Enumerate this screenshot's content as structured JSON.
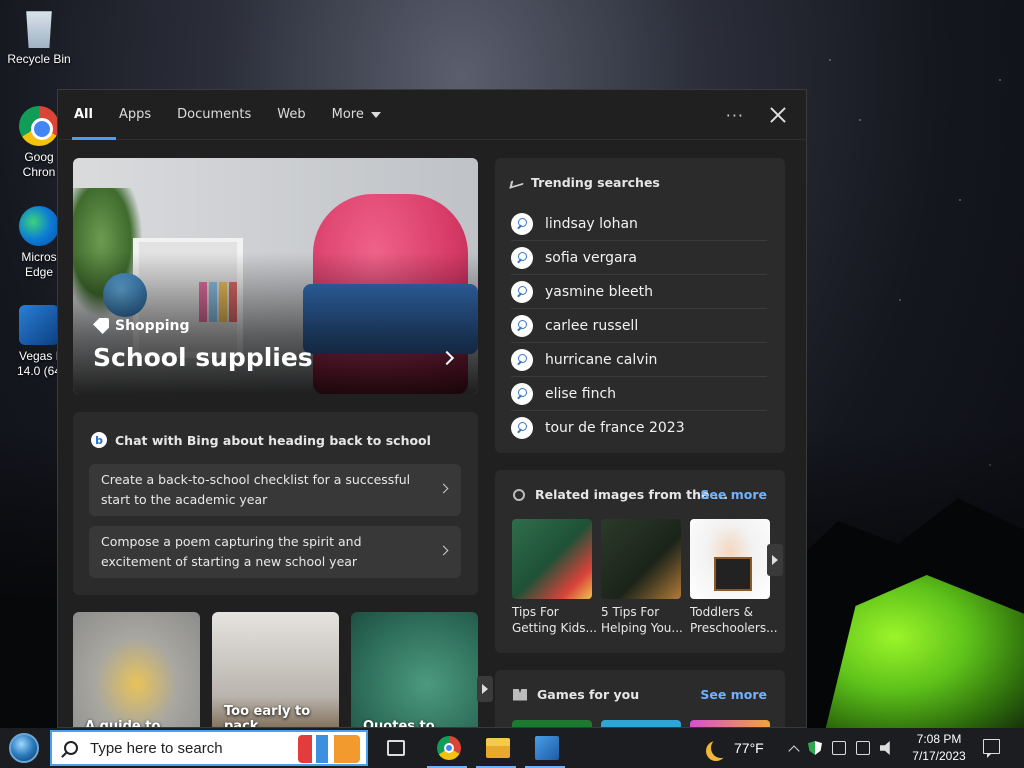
{
  "desktop": {
    "icons": [
      {
        "label": "Recycle Bin"
      },
      {
        "label": "Goog\nChron"
      },
      {
        "label": "Micros\nEdge"
      },
      {
        "label": "Vegas I\n14.0 (64"
      }
    ]
  },
  "tabs": {
    "items": [
      {
        "label": "All"
      },
      {
        "label": "Apps"
      },
      {
        "label": "Documents"
      },
      {
        "label": "Web"
      },
      {
        "label": "More"
      }
    ],
    "more_icon": "ellipsis-icon",
    "close_icon": "close-icon"
  },
  "hero": {
    "category": "Shopping",
    "title": "School supplies"
  },
  "chat": {
    "heading": "Chat with Bing about heading back to school",
    "prompts": [
      "Create a back-to-school checklist for a successful start to the academic year",
      "Compose a poem capturing the spirit and excitement of starting a new school year"
    ]
  },
  "tiles": [
    {
      "label": "A guide to"
    },
    {
      "label": "Too early to pack"
    },
    {
      "label": "Quotes to"
    }
  ],
  "trending": {
    "heading": "Trending searches",
    "items": [
      "lindsay lohan",
      "sofia vergara",
      "yasmine bleeth",
      "carlee russell",
      "hurricane calvin",
      "elise finch",
      "tour de france 2023"
    ]
  },
  "related_images": {
    "heading": "Related images from the ...",
    "see_more": "See more",
    "thumbs": [
      {
        "caption": "Tips For Getting Kids..."
      },
      {
        "caption": "5 Tips For Helping You..."
      },
      {
        "caption": "Toddlers & Preschoolers..."
      }
    ]
  },
  "games": {
    "heading": "Games for you",
    "see_more": "See more"
  },
  "taskbar": {
    "search_placeholder": "Type here to search",
    "weather": "77°F",
    "time": "7:08 PM",
    "date": "7/17/2023"
  },
  "colors": {
    "accent": "#4aa0f0",
    "link": "#6fb2ff",
    "panel_bg": "#202020",
    "card_bg": "#2b2b2b"
  }
}
